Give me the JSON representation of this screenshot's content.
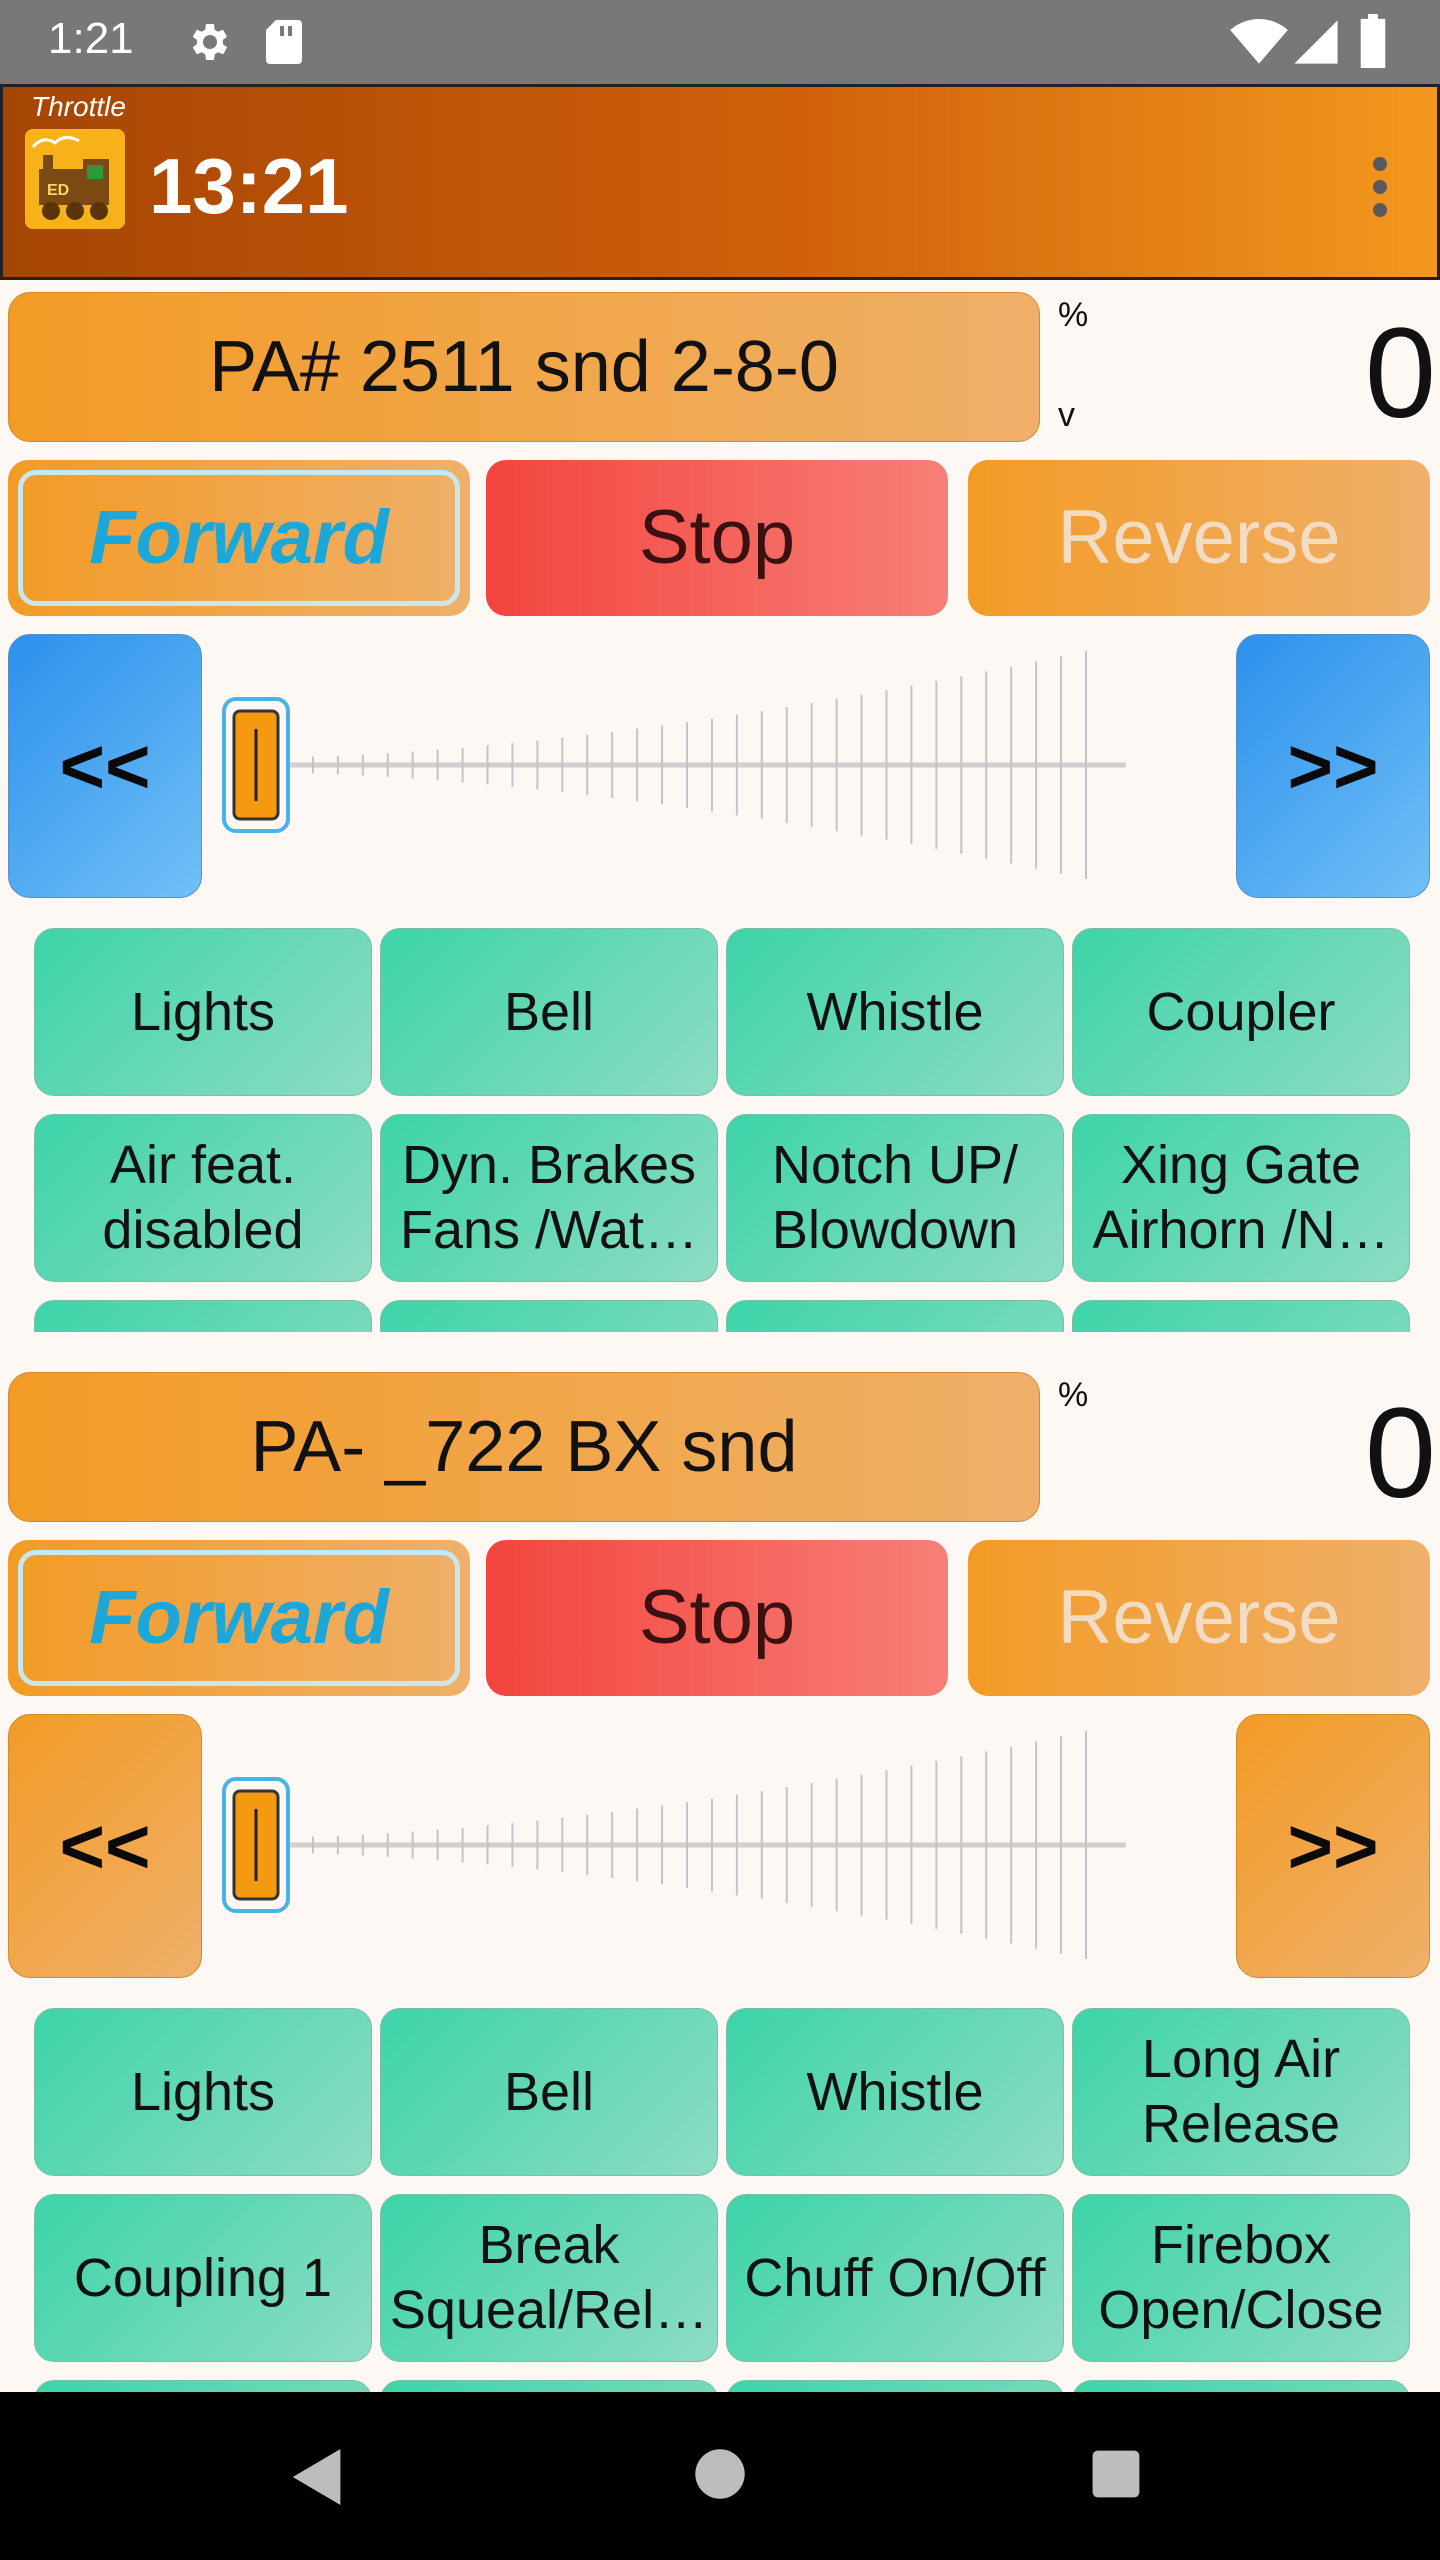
{
  "status_bar": {
    "time": "1:21"
  },
  "app_bar": {
    "subtitle": "Throttle",
    "title": "13:21"
  },
  "throttles": [
    {
      "loco_name": "PA# 2511 snd 2-8-0",
      "speed_unit": "%",
      "speed_unit_sub": "v",
      "speed_value": "0",
      "direction": {
        "forward": "Forward",
        "stop": "Stop",
        "reverse": "Reverse"
      },
      "step_down_label": "<<",
      "step_up_label": ">>",
      "slider_value_percent": 0,
      "functions": [
        [
          "Lights"
        ],
        [
          "Bell"
        ],
        [
          "Whistle"
        ],
        [
          "Coupler"
        ],
        [
          "Air feat.",
          "disabled"
        ],
        [
          "Dyn. Brakes",
          "Fans /Wat…"
        ],
        [
          "Notch UP/",
          "Blowdown"
        ],
        [
          "Xing Gate",
          "Airhorn /N…"
        ]
      ]
    },
    {
      "loco_name": "PA- _722 BX snd",
      "speed_unit": "%",
      "speed_value": "0",
      "direction": {
        "forward": "Forward",
        "stop": "Stop",
        "reverse": "Reverse"
      },
      "step_down_label": "<<",
      "step_up_label": ">>",
      "slider_value_percent": 0,
      "functions": [
        [
          "Lights"
        ],
        [
          "Bell"
        ],
        [
          "Whistle"
        ],
        [
          "Long Air",
          "Release"
        ],
        [
          "Coupling 1"
        ],
        [
          "Break",
          "Squeal/Rel…"
        ],
        [
          "Chuff On/Off"
        ],
        [
          "Firebox",
          "Open/Close"
        ]
      ]
    }
  ],
  "icons": {
    "status_left": [
      "gear-icon",
      "sd-card-icon"
    ],
    "status_right": [
      "wifi-icon",
      "cell-signal-icon",
      "battery-icon"
    ],
    "nav": [
      "back-icon",
      "home-icon",
      "recents-icon"
    ]
  },
  "colors": {
    "app_bar_start": "#a54505",
    "app_bar_end": "#f3981f",
    "loco_orange": "#f29b26",
    "stop_red": "#f2453e",
    "function_green": "#3dd4a8",
    "step_blue": "#2c90ec",
    "forward_text": "#1da7d8"
  }
}
